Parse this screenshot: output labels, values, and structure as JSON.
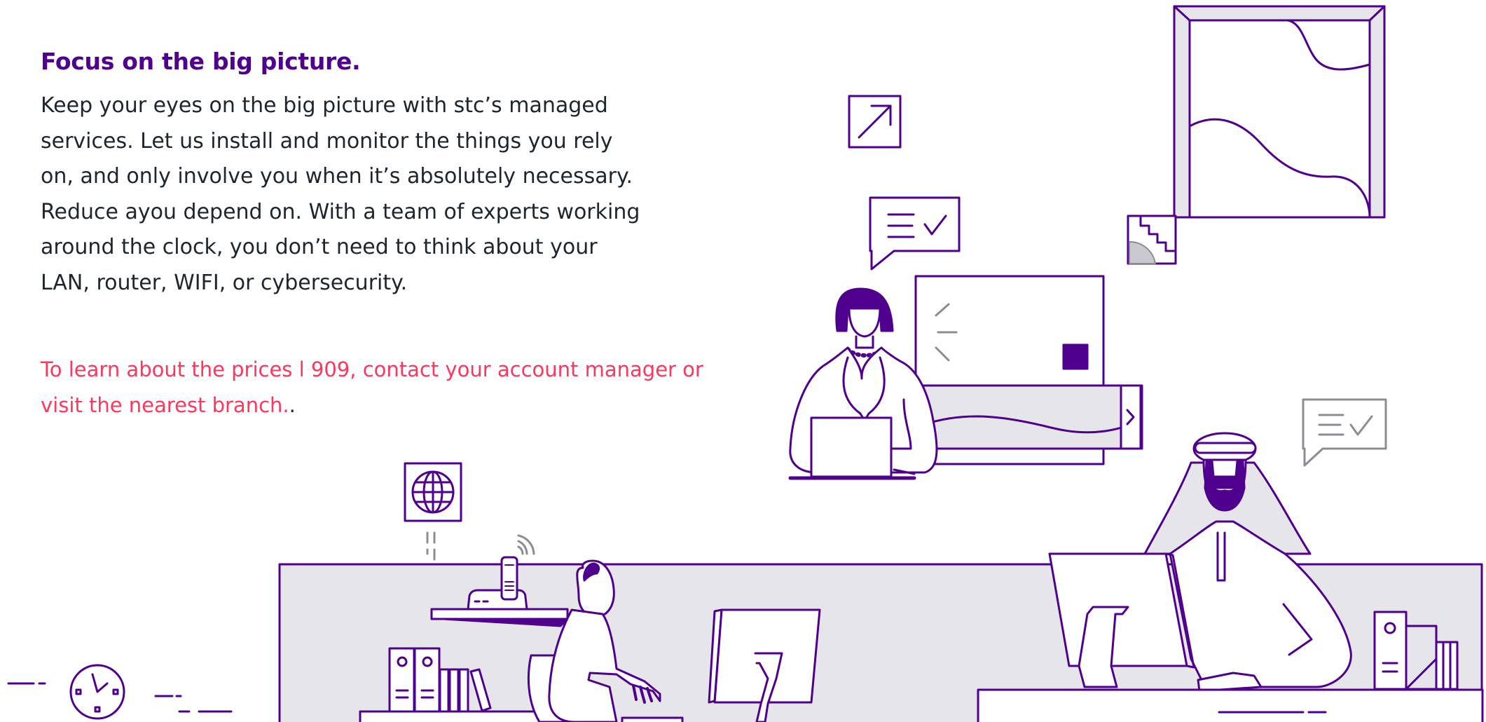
{
  "section": {
    "title": "Focus on the big picture.",
    "body": "Keep your eyes on the big picture with stc’s managed\nservices. Let us install and monitor the things you rely\non, and only involve you when it’s absolutely necessary.\nReduce ayou depend on. With a team of experts working\naround the clock, you don’t need to think about your\nLAN, router, WIFI, or cybersecurity.",
    "cta_main": "To learn about the prices l 909, contact your account manager or visit the nearest branch.",
    "cta_tail": "."
  },
  "colors": {
    "brand_purple": "#4f008c",
    "accent_pink": "#ff375e",
    "text_dark": "#1d252d",
    "panel_gray": "#e6e6ea",
    "line_gray": "#8c8c94"
  },
  "icons": [
    "arrow-up-right-icon",
    "message-check-icon",
    "globe-icon",
    "clock-icon",
    "chevron-right-icon",
    "wifi-icon",
    "cordless-phone-icon"
  ]
}
